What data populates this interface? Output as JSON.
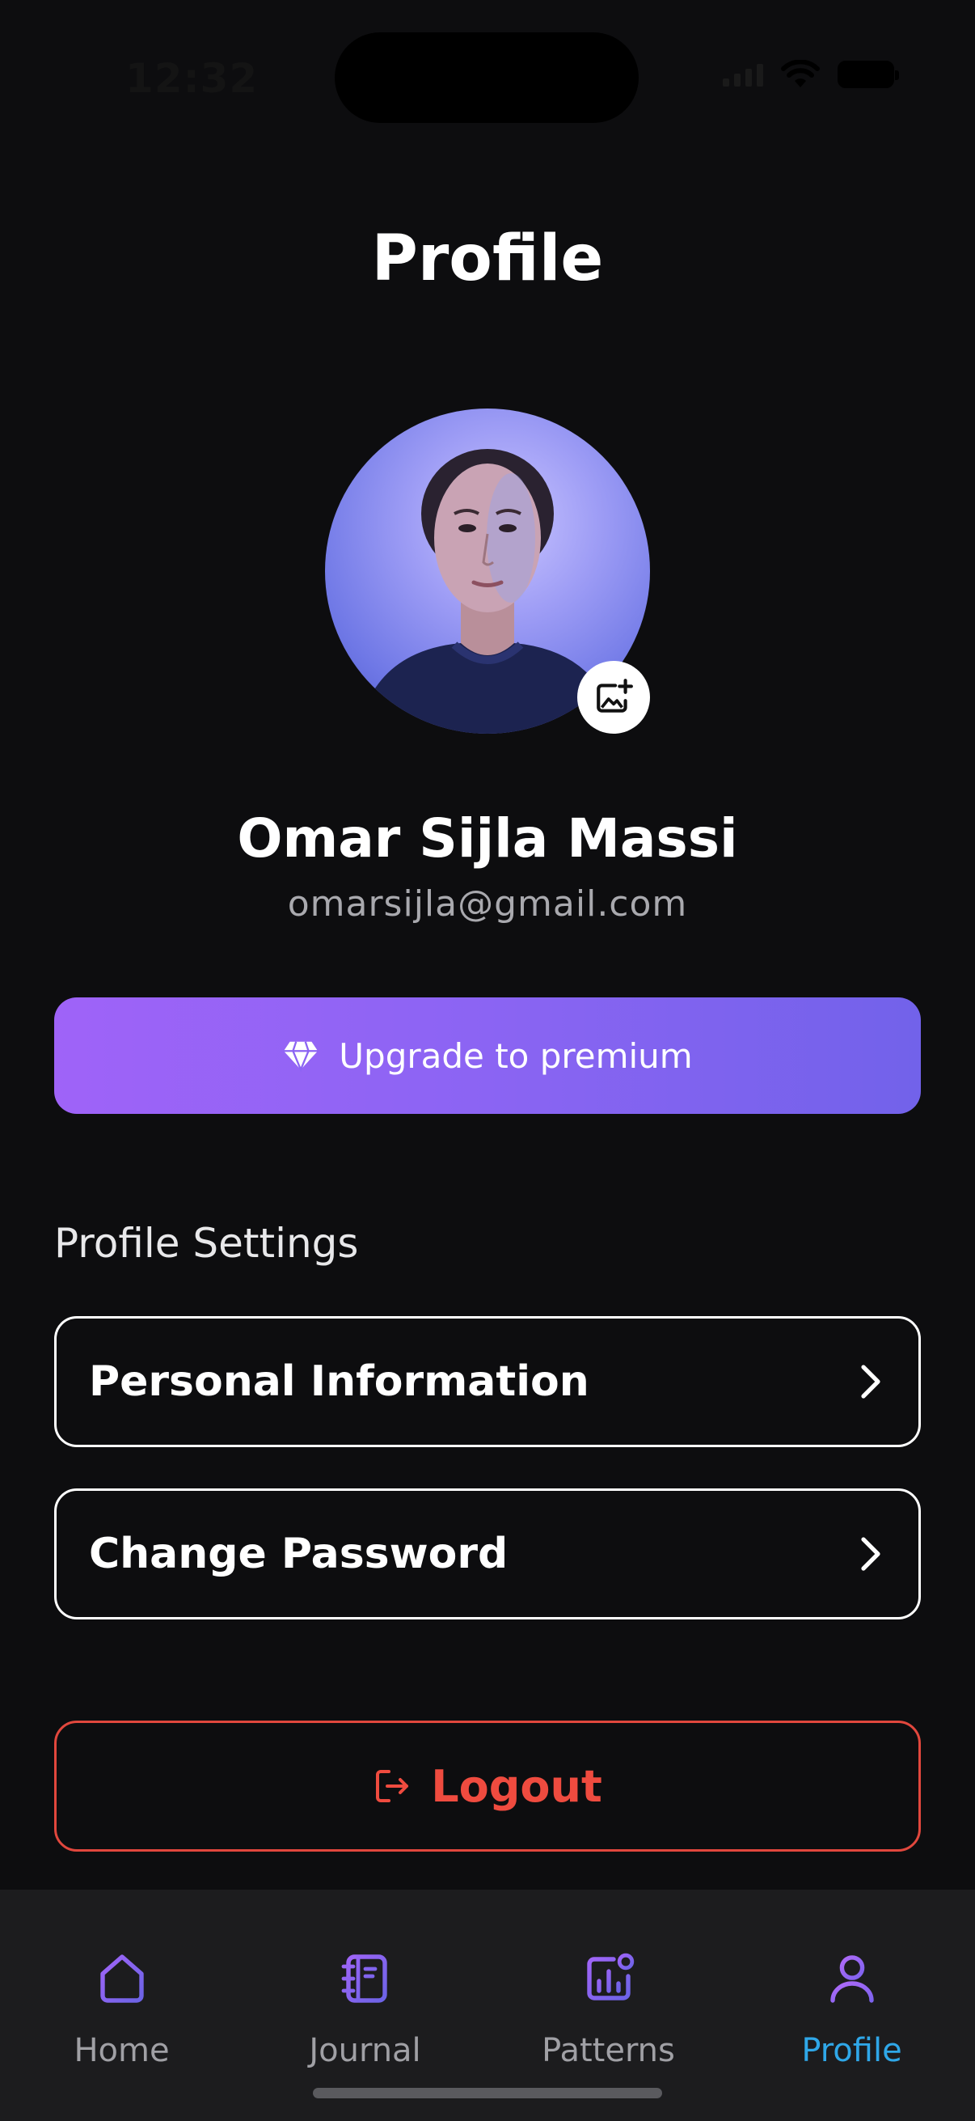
{
  "status_bar": {
    "time": "12:32"
  },
  "header": {
    "title": "Profile"
  },
  "profile": {
    "name": "Omar Sijla Massi",
    "email": "omarsijla@gmail.com",
    "edit_photo_icon": "add-photo-icon"
  },
  "premium": {
    "label": "Upgrade to premium",
    "icon": "diamond-icon"
  },
  "settings": {
    "title": "Profile Settings",
    "items": [
      {
        "label": "Personal Information",
        "icon": "chevron-right-icon"
      },
      {
        "label": "Change Password",
        "icon": "chevron-right-icon"
      }
    ]
  },
  "logout": {
    "label": "Logout",
    "icon": "logout-icon",
    "color": "#ef4b3f"
  },
  "tabs": [
    {
      "label": "Home",
      "icon": "home-icon",
      "active": false
    },
    {
      "label": "Journal",
      "icon": "journal-icon",
      "active": false
    },
    {
      "label": "Patterns",
      "icon": "patterns-icon",
      "active": false
    },
    {
      "label": "Profile",
      "icon": "profile-icon",
      "active": true
    }
  ],
  "colors": {
    "background": "#0d0d0f",
    "accent": "#8b64f3",
    "active_tab": "#2fa7e8",
    "danger": "#ef4b3f",
    "tab_bar": "#1c1c1e"
  }
}
